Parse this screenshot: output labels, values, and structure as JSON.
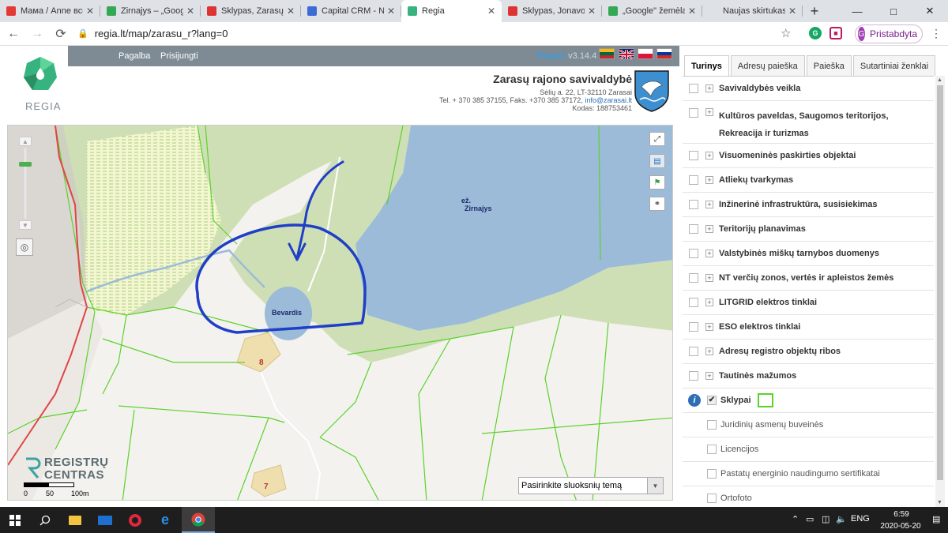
{
  "browser": {
    "tabs": [
      {
        "label": "Мама / Anne все",
        "fav_color": "#e53935"
      },
      {
        "label": "Zirnajys – „Google",
        "fav_color": "#34a853"
      },
      {
        "label": "Sklypas, Zarasų r.",
        "fav_color": "#d33"
      },
      {
        "label": "Capital CRM - NT",
        "fav_color": "#3b6bd3"
      },
      {
        "label": "Regia",
        "fav_color": "#36b37e",
        "active": true
      },
      {
        "label": "Sklypas, Jonavos r",
        "fav_color": "#d33"
      },
      {
        "label": "„Google\" žemėlap",
        "fav_color": "#34a853"
      },
      {
        "label": "Naujas skirtukas",
        "fav_color": ""
      }
    ],
    "url": "regia.lt/map/zarasu_r?lang=0",
    "profile_initial": "G",
    "profile_label": "Pristabdyta"
  },
  "header": {
    "nav": [
      "Pagalba",
      "Prisijungti"
    ],
    "version_brand": "Regia2",
    "version": "v3.14.4",
    "logo_text": "REGIA",
    "municipality_title": "Zarasų rajono savivaldybė",
    "address": "Sėlių a. 22, LT-32110 Zarasai",
    "contacts_prefix": "Tel. + 370 385 37155, Faks. +370 385 37172, ",
    "email": "info@zarasai.lt",
    "code": "Kodas: 188753461"
  },
  "map": {
    "lake_label_1": "ež.",
    "lake_label_2": "Zirnajys",
    "small_lake_label": "Bevardis",
    "plot_8": "8",
    "plot_7": "7",
    "rc_line1": "REGISTRŲ",
    "rc_line2": "CENTRAS",
    "scale_labels": [
      "0",
      "50",
      "100m"
    ],
    "layer_select_placeholder": "Pasirinkite sluoksnių temą",
    "colors": {
      "lake": "#9cbbd9",
      "forest": "#cfdfb5",
      "meadow": "#f1f5d0",
      "plot_boundary": "#5bd22c",
      "annotation": "#1f3fc7",
      "border": "#e04545"
    }
  },
  "panel": {
    "tabs": [
      "Turinys",
      "Adresų paieška",
      "Paieška",
      "Sutartiniai ženklai"
    ],
    "layers": [
      "Savivaldybės veikla",
      "Kultūros paveldas, Saugomos teritorijos, Rekreacija ir turizmas",
      "Visuomeninės paskirties objektai",
      "Atliekų tvarkymas",
      "Inžinerinė infrastruktūra, susisiekimas",
      "Teritorijų planavimas",
      "Valstybinės miškų tarnybos duomenys",
      "NT verčių zonos, vertės ir apleistos žemės",
      "LITGRID elektros tinklai",
      "ESO elektros tinklai",
      "Adresų registro objektų ribos",
      "Tautinės mažumos"
    ],
    "sklypai": "Sklypai",
    "sub_layers": [
      "Juridinių asmenų buveinės",
      "Licencijos",
      "Pastatų energinio naudingumo sertifikatai",
      "Ortofoto"
    ]
  },
  "taskbar": {
    "lang": "ENG",
    "time": "6:59",
    "date": "2020-05-20"
  }
}
